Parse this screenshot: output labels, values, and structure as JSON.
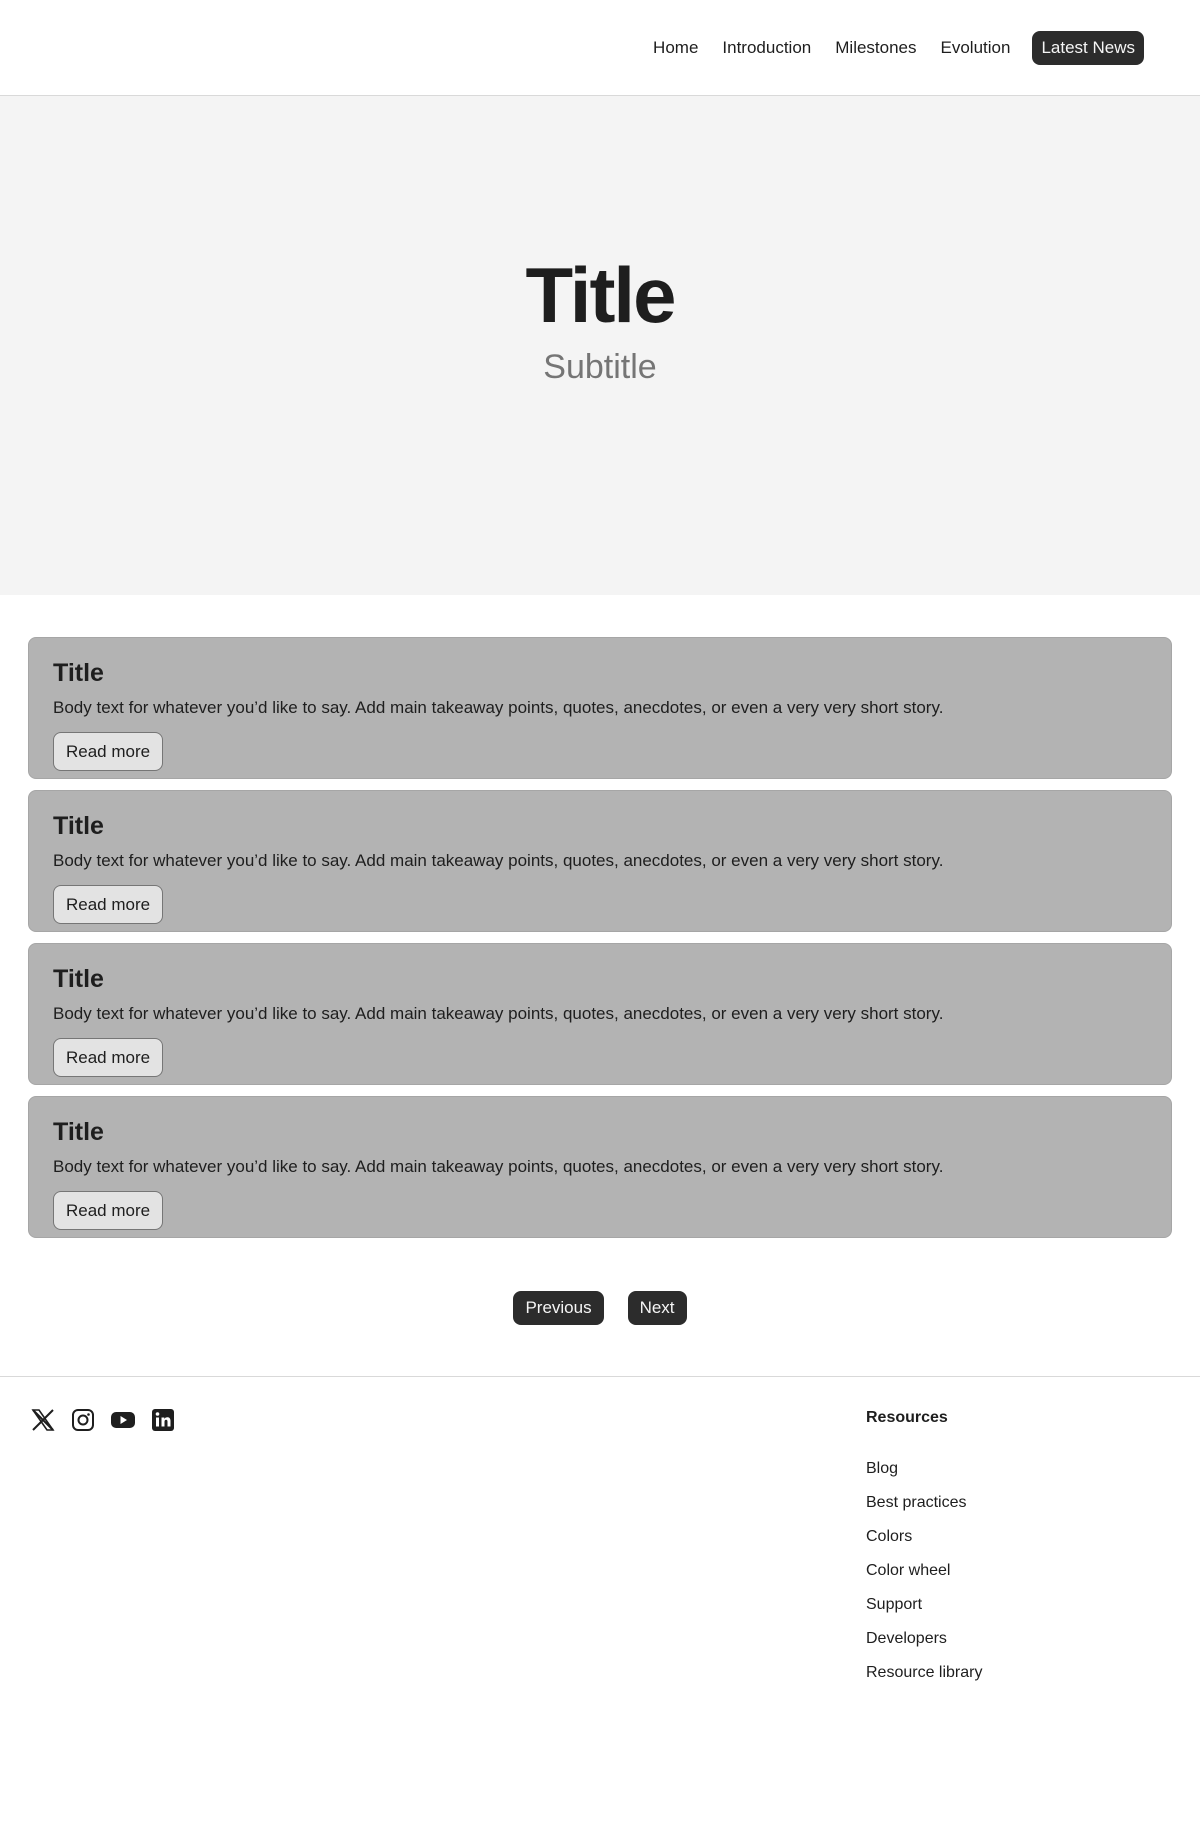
{
  "nav": {
    "items": [
      {
        "label": "Home"
      },
      {
        "label": "Introduction"
      },
      {
        "label": "Milestones"
      },
      {
        "label": "Evolution"
      },
      {
        "label": "Latest News"
      }
    ]
  },
  "hero": {
    "title": "Title",
    "subtitle": "Subtitle"
  },
  "cards": [
    {
      "title": "Title",
      "body": "Body text for whatever you’d like to say. Add main takeaway points, quotes, anecdotes, or even a very very short story.",
      "button": "Read more"
    },
    {
      "title": "Title",
      "body": "Body text for whatever you’d like to say. Add main takeaway points, quotes, anecdotes, or even a very very short story.",
      "button": "Read more"
    },
    {
      "title": "Title",
      "body": "Body text for whatever you’d like to say. Add main takeaway points, quotes, anecdotes, or even a very very short story.",
      "button": "Read more"
    },
    {
      "title": "Title",
      "body": "Body text for whatever you’d like to say. Add main takeaway points, quotes, anecdotes, or even a very very short story.",
      "button": "Read more"
    }
  ],
  "pagination": {
    "previous": "Previous",
    "next": "Next"
  },
  "footer": {
    "social_icons": [
      "x-icon",
      "instagram-icon",
      "youtube-icon",
      "linkedin-icon"
    ],
    "resources": {
      "heading": "Resources",
      "links": [
        "Blog",
        "Best practices",
        "Colors",
        "Color wheel",
        "Support",
        "Developers",
        "Resource library"
      ]
    }
  },
  "colors": {
    "header_border": "#d9d9d9",
    "hero_bg": "#f4f4f4",
    "card_bg": "#b3b3b3",
    "dark_button": "#2c2c2c",
    "text": "#1e1e1e",
    "subtitle": "#757575"
  }
}
